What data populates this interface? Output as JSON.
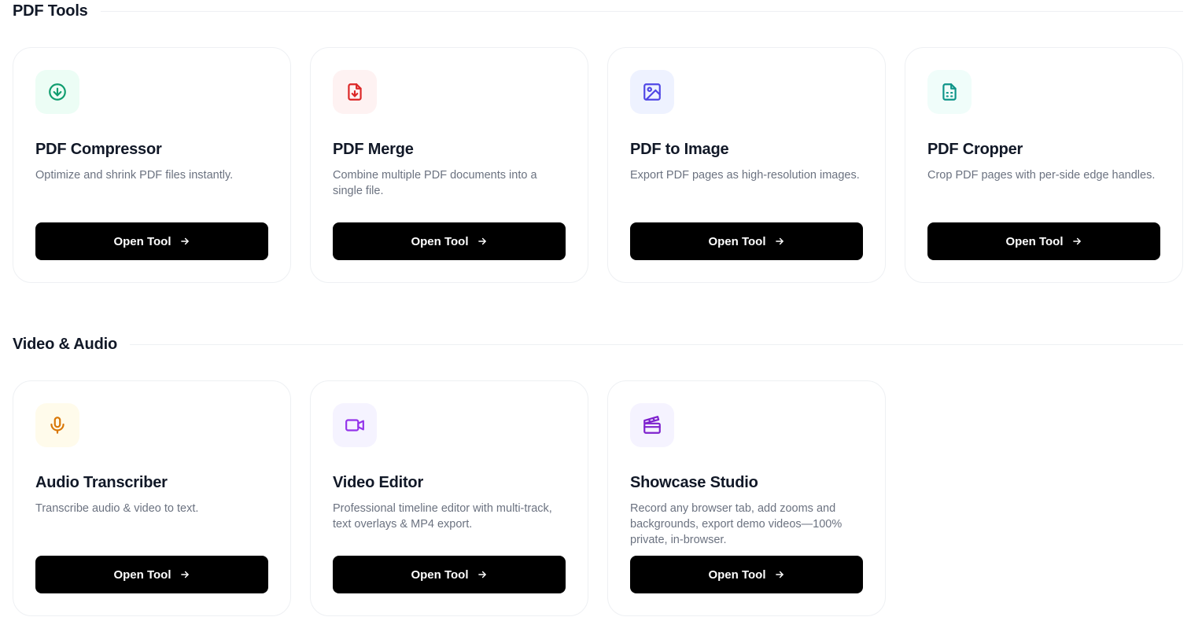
{
  "sections": [
    {
      "title": "PDF Tools",
      "cards": [
        {
          "title": "PDF Compressor",
          "description": "Optimize and shrink PDF files instantly.",
          "button_label": "Open Tool",
          "icon": "download-circle-icon",
          "icon_color": "#0f9d6e",
          "icon_bg": "#ecfdf5"
        },
        {
          "title": "PDF Merge",
          "description": "Combine multiple PDF documents into a single file.",
          "button_label": "Open Tool",
          "icon": "file-download-icon",
          "icon_color": "#dc2626",
          "icon_bg": "#fef2f2"
        },
        {
          "title": "PDF to Image",
          "description": "Export PDF pages as high-resolution images.",
          "button_label": "Open Tool",
          "icon": "image-icon",
          "icon_color": "#4f46e5",
          "icon_bg": "#eef2ff"
        },
        {
          "title": "PDF Cropper",
          "description": "Crop PDF pages with per-side edge handles.",
          "button_label": "Open Tool",
          "icon": "file-text-icon",
          "icon_color": "#0d9488",
          "icon_bg": "#f0fdfa"
        }
      ]
    },
    {
      "title": "Video & Audio",
      "cards": [
        {
          "title": "Audio Transcriber",
          "description": "Transcribe audio & video to text.",
          "button_label": "Open Tool",
          "icon": "microphone-icon",
          "icon_color": "#d97706",
          "icon_bg": "#fffbeb"
        },
        {
          "title": "Video Editor",
          "description": "Professional timeline editor with multi-track, text overlays & MP4 export.",
          "button_label": "Open Tool",
          "icon": "video-camera-icon",
          "icon_color": "#9333ea",
          "icon_bg": "#f5f3ff"
        },
        {
          "title": "Showcase Studio",
          "description": "Record any browser tab, add zooms and backgrounds, export demo videos—100% private, in-browser.",
          "button_label": "Open Tool",
          "icon": "clapperboard-icon",
          "icon_color": "#7e22ce",
          "icon_bg": "#f5f3ff"
        }
      ]
    }
  ]
}
